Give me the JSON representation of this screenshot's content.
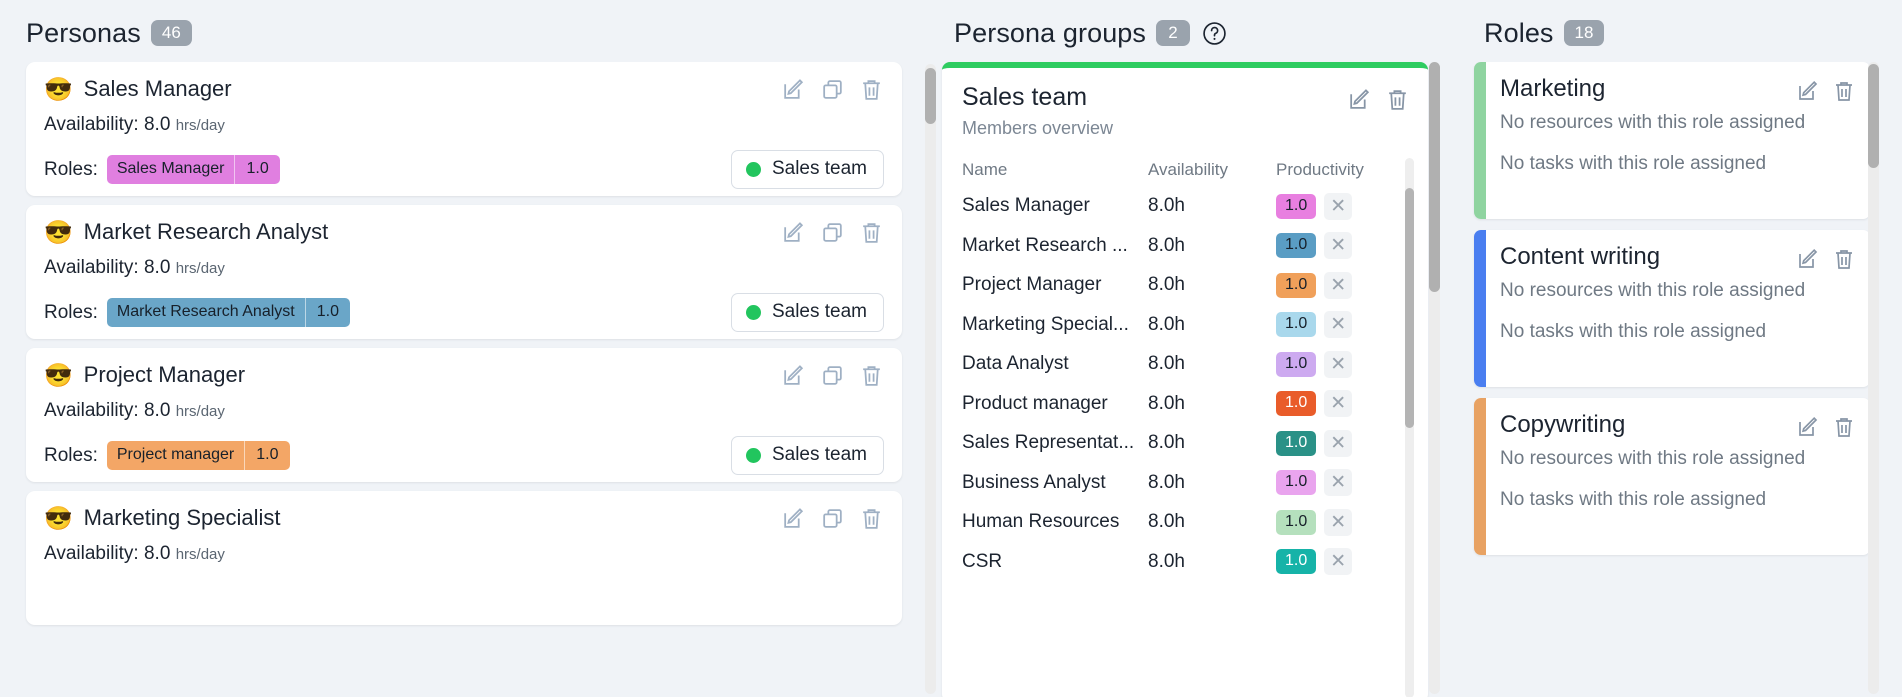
{
  "personas": {
    "title": "Personas",
    "count": "46",
    "labels": {
      "availability_prefix": "Availability:",
      "availability_unit": "hrs/day",
      "roles_label": "Roles:"
    },
    "icons": {
      "edit": "edit-icon",
      "duplicate": "duplicate-icon",
      "delete": "delete-icon",
      "avatar": "😎"
    },
    "items": [
      {
        "name": "Sales Manager",
        "availability": "8.0",
        "role": "Sales Manager",
        "role_value": "1.0",
        "role_color": "#e07fe0",
        "team": "Sales team",
        "team_color": "#22c55e"
      },
      {
        "name": "Market Research Analyst",
        "availability": "8.0",
        "role": "Market Research Analyst",
        "role_value": "1.0",
        "role_color": "#6aa6c8",
        "team": "Sales team",
        "team_color": "#22c55e"
      },
      {
        "name": "Project Manager",
        "availability": "8.0",
        "role": "Project manager",
        "role_value": "1.0",
        "role_color": "#f3a666",
        "team": "Sales team",
        "team_color": "#22c55e"
      },
      {
        "name": "Marketing Specialist",
        "availability": "8.0",
        "role": "",
        "role_value": "",
        "role_color": "#a9d8ec",
        "team": "Sales team",
        "team_color": "#22c55e"
      }
    ]
  },
  "persona_groups": {
    "title": "Persona groups",
    "count": "2",
    "help_icon": "help-circle-icon",
    "group": {
      "accent_color": "#2ecc60",
      "name": "Sales team",
      "subtitle": "Members overview",
      "icons": {
        "edit": "edit-icon",
        "delete": "delete-icon"
      },
      "columns": {
        "name": "Name",
        "availability": "Availability",
        "productivity": "Productivity"
      },
      "remove_icon": "close-icon",
      "members": [
        {
          "name": "Sales Manager",
          "availability": "8.0h",
          "productivity": "1.0",
          "color": "#e87fe0"
        },
        {
          "name": "Market Research ...",
          "availability": "8.0h",
          "productivity": "1.0",
          "color": "#5a9dc4"
        },
        {
          "name": "Project Manager",
          "availability": "8.0h",
          "productivity": "1.0",
          "color": "#f0a05a"
        },
        {
          "name": "Marketing Special...",
          "availability": "8.0h",
          "productivity": "1.0",
          "color": "#a9d8ec"
        },
        {
          "name": "Data Analyst",
          "availability": "8.0h",
          "productivity": "1.0",
          "color": "#cdaaf0"
        },
        {
          "name": "Product manager",
          "availability": "8.0h",
          "productivity": "1.0",
          "color": "#e95c2a"
        },
        {
          "name": "Sales Representat...",
          "availability": "8.0h",
          "productivity": "1.0",
          "color": "#2a9187"
        },
        {
          "name": "Business Analyst",
          "availability": "8.0h",
          "productivity": "1.0",
          "color": "#e9a4ee"
        },
        {
          "name": "Human Resources",
          "availability": "8.0h",
          "productivity": "1.0",
          "color": "#b5e0bd"
        },
        {
          "name": "CSR",
          "availability": "8.0h",
          "productivity": "1.0",
          "color": "#16b3a8"
        }
      ]
    }
  },
  "roles": {
    "title": "Roles",
    "count": "18",
    "no_resources_text": "No resources with this role assigned",
    "no_tasks_text": "No tasks with this role assigned",
    "icons": {
      "edit": "edit-icon",
      "delete": "delete-icon"
    },
    "items": [
      {
        "name": "Marketing",
        "accent_color": "#8fd4a0"
      },
      {
        "name": "Content writing",
        "accent_color": "#4a7ef0"
      },
      {
        "name": "Copywriting",
        "accent_color": "#e8a263"
      }
    ]
  }
}
